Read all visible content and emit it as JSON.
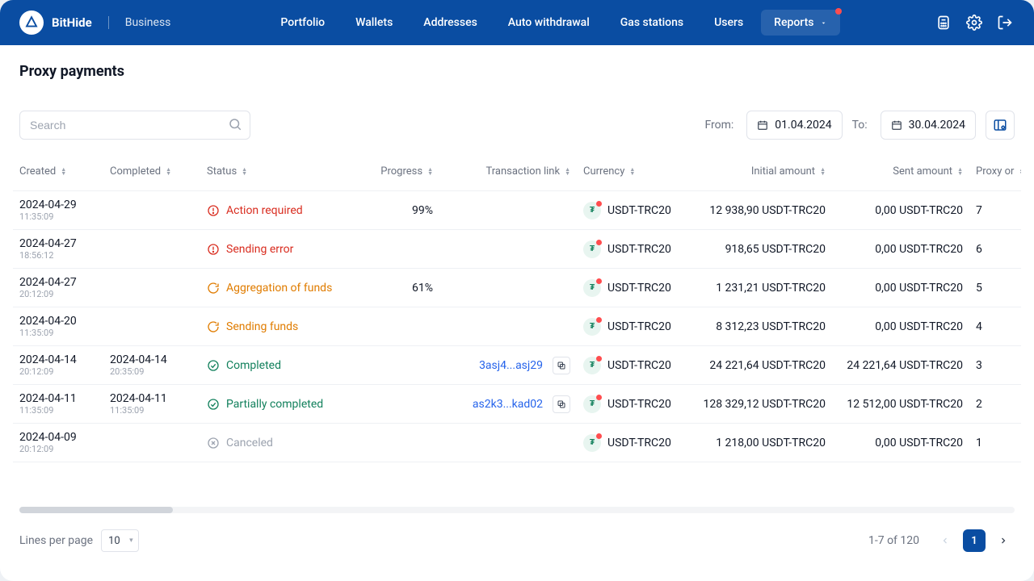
{
  "header": {
    "brand": "BitHide",
    "subbrand": "Business",
    "nav": [
      {
        "label": "Portfolio",
        "active": false,
        "dropdown": false
      },
      {
        "label": "Wallets",
        "active": false,
        "dropdown": false
      },
      {
        "label": "Addresses",
        "active": false,
        "dropdown": false
      },
      {
        "label": "Auto withdrawal",
        "active": false,
        "dropdown": false
      },
      {
        "label": "Gas stations",
        "active": false,
        "dropdown": false
      },
      {
        "label": "Users",
        "active": false,
        "dropdown": false
      },
      {
        "label": "Reports",
        "active": true,
        "dropdown": true,
        "badge": true
      }
    ]
  },
  "page": {
    "title": "Proxy payments"
  },
  "filters": {
    "search_placeholder": "Search",
    "from_label": "From:",
    "from_value": "01.04.2024",
    "to_label": "To:",
    "to_value": "30.04.2024"
  },
  "columns": [
    {
      "key": "created",
      "label": "Created",
      "align": "left"
    },
    {
      "key": "completed",
      "label": "Completed",
      "align": "left"
    },
    {
      "key": "status",
      "label": "Status",
      "align": "left"
    },
    {
      "key": "progress",
      "label": "Progress",
      "align": "right"
    },
    {
      "key": "txlink",
      "label": "Transaction link",
      "align": "right"
    },
    {
      "key": "currency",
      "label": "Currency",
      "align": "left"
    },
    {
      "key": "initial",
      "label": "Initial amount",
      "align": "right"
    },
    {
      "key": "sent",
      "label": "Sent amount",
      "align": "right"
    },
    {
      "key": "proxy",
      "label": "Proxy or",
      "align": "left"
    }
  ],
  "rows": [
    {
      "created_date": "2024-04-29",
      "created_time": "11:35:09",
      "completed_date": "",
      "completed_time": "",
      "status_text": "Action required",
      "status_kind": "alert",
      "progress": "99%",
      "txlink": "",
      "currency": "USDT-TRC20",
      "initial": "12 938,90 USDT-TRC20",
      "sent": "0,00 USDT-TRC20",
      "proxy": "7"
    },
    {
      "created_date": "2024-04-27",
      "created_time": "18:56:12",
      "completed_date": "",
      "completed_time": "",
      "status_text": "Sending error",
      "status_kind": "alert",
      "progress": "",
      "txlink": "",
      "currency": "USDT-TRC20",
      "initial": "918,65 USDT-TRC20",
      "sent": "0,00 USDT-TRC20",
      "proxy": "6"
    },
    {
      "created_date": "2024-04-27",
      "created_time": "20:12:09",
      "completed_date": "",
      "completed_time": "",
      "status_text": "Aggregation of funds",
      "status_kind": "progress",
      "progress": "61%",
      "txlink": "",
      "currency": "USDT-TRC20",
      "initial": "1 231,21 USDT-TRC20",
      "sent": "0,00 USDT-TRC20",
      "proxy": "5"
    },
    {
      "created_date": "2024-04-20",
      "created_time": "11:35:09",
      "completed_date": "",
      "completed_time": "",
      "status_text": "Sending funds",
      "status_kind": "progress",
      "progress": "",
      "txlink": "",
      "currency": "USDT-TRC20",
      "initial": "8 312,23 USDT-TRC20",
      "sent": "0,00 USDT-TRC20",
      "proxy": "4"
    },
    {
      "created_date": "2024-04-14",
      "created_time": "20:12:09",
      "completed_date": "2024-04-14",
      "completed_time": "20:35:09",
      "status_text": "Completed",
      "status_kind": "done",
      "progress": "",
      "txlink": "3asj4...asj29",
      "currency": "USDT-TRC20",
      "initial": "24 221,64 USDT-TRC20",
      "sent": "24 221,64 USDT-TRC20",
      "proxy": "3"
    },
    {
      "created_date": "2024-04-11",
      "created_time": "11:35:09",
      "completed_date": "2024-04-11",
      "completed_time": "11:35:09",
      "status_text": "Partially completed",
      "status_kind": "done",
      "progress": "",
      "txlink": "as2k3...kad02",
      "currency": "USDT-TRC20",
      "initial": "128 329,12 USDT-TRC20",
      "sent": "12 512,00 USDT-TRC20",
      "proxy": "2"
    },
    {
      "created_date": "2024-04-09",
      "created_time": "20:12:09",
      "completed_date": "",
      "completed_time": "",
      "status_text": "Canceled",
      "status_kind": "cancel",
      "progress": "",
      "txlink": "",
      "currency": "USDT-TRC20",
      "initial": "1 218,00 USDT-TRC20",
      "sent": "0,00 USDT-TRC20",
      "proxy": "1"
    }
  ],
  "footer": {
    "per_page_label": "Lines per page",
    "per_page_value": "10",
    "range": "1-7 of 120",
    "current_page": "1"
  }
}
